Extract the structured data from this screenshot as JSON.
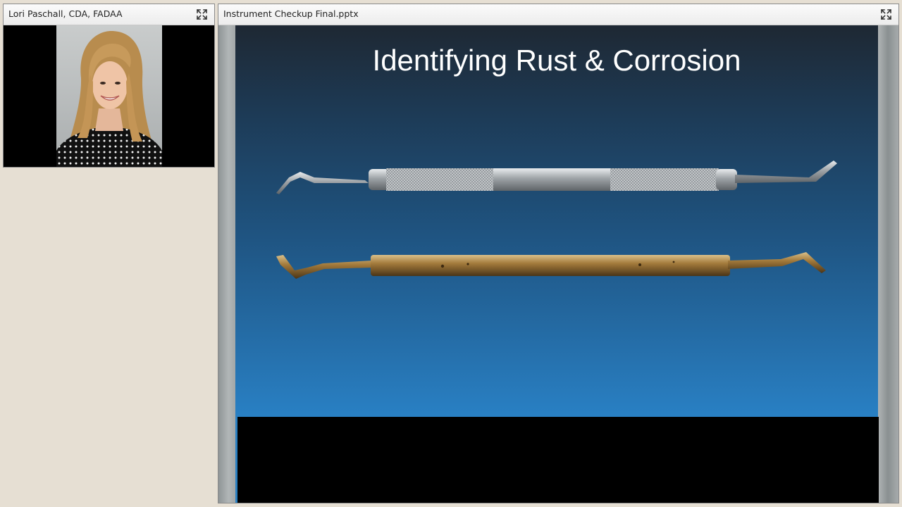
{
  "presenter": {
    "name": "Lori Paschall, CDA, FADAA",
    "expand_icon": "expand-icon"
  },
  "presentation": {
    "filename": "Instrument Checkup Final.pptx",
    "expand_icon": "expand-icon",
    "slide": {
      "title": "Identifying Rust & Corrosion",
      "images": [
        "clean-stainless-instrument",
        "rusted-corroded-instrument"
      ]
    }
  },
  "colors": {
    "background": "#e6dfd3",
    "slide_top": "#1e2833",
    "slide_bottom": "#2980c4",
    "title_text": "#ffffff"
  }
}
